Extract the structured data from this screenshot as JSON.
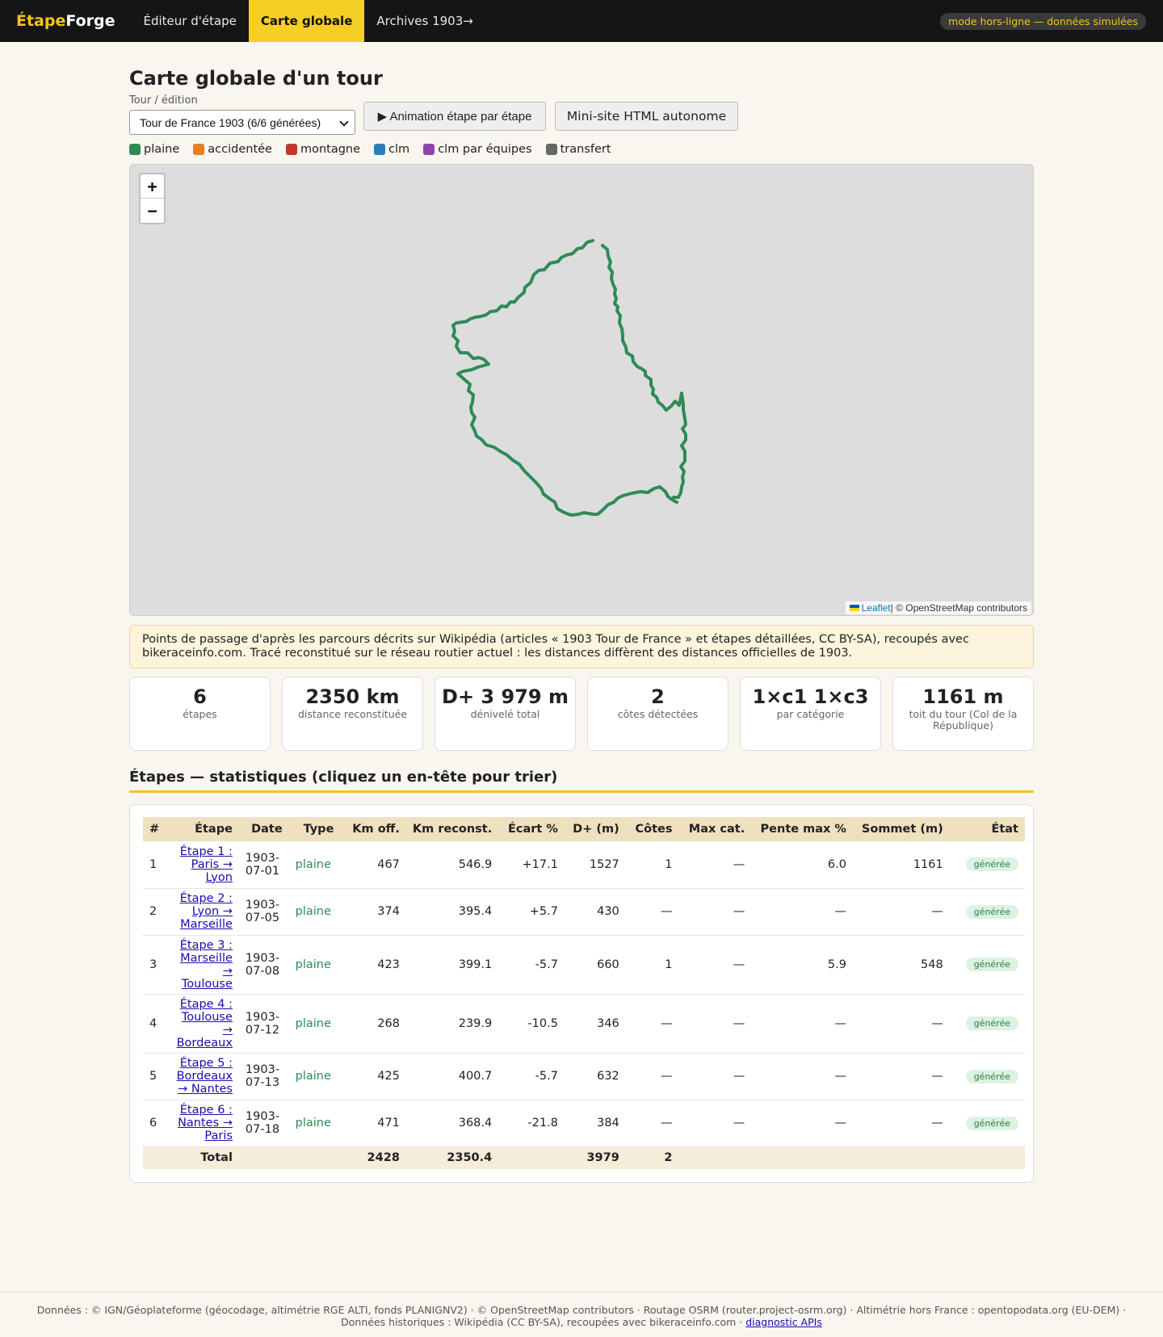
{
  "nav": {
    "brand_part1": "Étape",
    "brand_part2": "Forge",
    "items": [
      "Éditeur d'étape",
      "Carte globale",
      "Archives 1903→"
    ],
    "offline_badge": "mode hors-ligne — données simulées"
  },
  "page": {
    "title": "Carte globale d'un tour",
    "tour_label": "Tour / édition",
    "tour_selected": "Tour de France 1903 (6/6 générées)",
    "btn_animation": "▶ Animation étape par étape",
    "btn_minisite": "Mini-site HTML autonome"
  },
  "legend": [
    {
      "label": "plaine",
      "color": "#2e8b57"
    },
    {
      "label": "accidentée",
      "color": "#e67e22"
    },
    {
      "label": "montagne",
      "color": "#c0392b"
    },
    {
      "label": "clm",
      "color": "#2980b9"
    },
    {
      "label": "clm par équipes",
      "color": "#8e44ad"
    },
    {
      "label": "transfert",
      "color": "#666666"
    }
  ],
  "map": {
    "zoom_in": "+",
    "zoom_out": "−",
    "attribution_link": "Leaflet",
    "attribution_text": " | © OpenStreetMap contributors",
    "route_color": "#2e8b57"
  },
  "notice": "Points de passage d'après les parcours décrits sur Wikipédia (articles « 1903 Tour de France » et étapes détaillées, CC BY-SA), recoupés avec bikeraceinfo.com. Tracé reconstitué sur le réseau routier actuel : les distances diffèrent des distances officielles de 1903.",
  "stats": [
    {
      "value": "6",
      "label": "étapes"
    },
    {
      "value": "2350 km",
      "label": "distance reconstituée"
    },
    {
      "value": "D+ 3 979 m",
      "label": "dénivelé total"
    },
    {
      "value": "2",
      "label": "côtes détectées"
    },
    {
      "value": "1×c1 1×c3",
      "label": "par catégorie"
    },
    {
      "value": "1161 m",
      "label": "toit du tour (Col de la République)"
    }
  ],
  "table": {
    "section_title": "Étapes — statistiques (cliquez un en-tête pour trier)",
    "headers": [
      "#",
      "Étape",
      "Date",
      "Type",
      "Km off.",
      "Km reconst.",
      "Écart %",
      "D+ (m)",
      "Côtes",
      "Max cat.",
      "Pente max %",
      "Sommet (m)",
      "État"
    ],
    "rows": [
      {
        "n": "1",
        "etape": "Étape 1 : Paris → Lyon",
        "date": "1903-07-01",
        "type": "plaine",
        "km_off": "467",
        "km_rec": "546.9",
        "ecart": "+17.1",
        "dplus": "1527",
        "cotes": "1",
        "maxcat": "—",
        "pente": "6.0",
        "sommet": "1161",
        "etat": "générée"
      },
      {
        "n": "2",
        "etape": "Étape 2 : Lyon → Marseille",
        "date": "1903-07-05",
        "type": "plaine",
        "km_off": "374",
        "km_rec": "395.4",
        "ecart": "+5.7",
        "dplus": "430",
        "cotes": "—",
        "maxcat": "—",
        "pente": "—",
        "sommet": "—",
        "etat": "générée"
      },
      {
        "n": "3",
        "etape": "Étape 3 : Marseille → Toulouse",
        "date": "1903-07-08",
        "type": "plaine",
        "km_off": "423",
        "km_rec": "399.1",
        "ecart": "-5.7",
        "dplus": "660",
        "cotes": "1",
        "maxcat": "—",
        "pente": "5.9",
        "sommet": "548",
        "etat": "générée"
      },
      {
        "n": "4",
        "etape": "Étape 4 : Toulouse → Bordeaux",
        "date": "1903-07-12",
        "type": "plaine",
        "km_off": "268",
        "km_rec": "239.9",
        "ecart": "-10.5",
        "dplus": "346",
        "cotes": "—",
        "maxcat": "—",
        "pente": "—",
        "sommet": "—",
        "etat": "générée"
      },
      {
        "n": "5",
        "etape": "Étape 5 : Bordeaux → Nantes",
        "date": "1903-07-13",
        "type": "plaine",
        "km_off": "425",
        "km_rec": "400.7",
        "ecart": "-5.7",
        "dplus": "632",
        "cotes": "—",
        "maxcat": "—",
        "pente": "—",
        "sommet": "—",
        "etat": "générée"
      },
      {
        "n": "6",
        "etape": "Étape 6 : Nantes → Paris",
        "date": "1903-07-18",
        "type": "plaine",
        "km_off": "471",
        "km_rec": "368.4",
        "ecart": "-21.8",
        "dplus": "384",
        "cotes": "—",
        "maxcat": "—",
        "pente": "—",
        "sommet": "—",
        "etat": "générée"
      }
    ],
    "total": {
      "label": "Total",
      "km_off": "2428",
      "km_rec": "2350.4",
      "dplus": "3979",
      "cotes": "2"
    }
  },
  "footer": {
    "text": "Données : © IGN/Géoplateforme (géocodage, altimétrie RGE ALTI, fonds PLANIGNV2) · © OpenStreetMap contributors · Routage OSRM (router.project-osrm.org) · Altimétrie hors France : opentopodata.org (EU-DEM) · Données historiques : Wikipédia (CC BY-SA), recoupées avec bikeraceinfo.com · ",
    "link": "diagnostic APIs"
  }
}
